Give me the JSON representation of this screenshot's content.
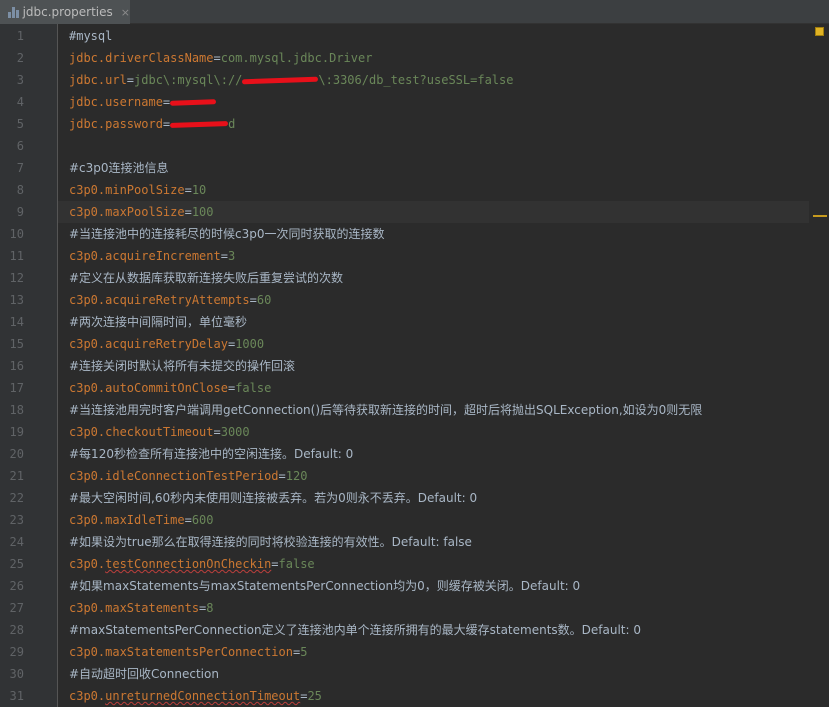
{
  "tab": {
    "filename": "jdbc.properties",
    "close_glyph": "×",
    "icon": "properties-file-icon"
  },
  "colors": {
    "key": "#cc7832",
    "value": "#6a8759",
    "comment": "#a9b7c6",
    "background": "#2b2b2b",
    "gutter": "#313335",
    "line_number": "#606366",
    "warning_marker": "#e0b324"
  },
  "lines": [
    {
      "n": "1",
      "type": "comment",
      "text": "#mysql"
    },
    {
      "n": "2",
      "type": "prop",
      "key": "jdbc.driverClassName",
      "value": "com.mysql.jdbc.Driver"
    },
    {
      "n": "3",
      "type": "prop",
      "key": "jdbc.url",
      "value_pre": "jdbc\\:mysql\\://",
      "value_post": "\\:3306/db_test?useSSL=false",
      "redacted": true
    },
    {
      "n": "4",
      "type": "prop",
      "key": "jdbc.username",
      "value": "",
      "redacted": true
    },
    {
      "n": "5",
      "type": "prop",
      "key": "jdbc.password",
      "value": "d",
      "redacted": true
    },
    {
      "n": "6",
      "type": "blank",
      "text": ""
    },
    {
      "n": "7",
      "type": "comment",
      "text": "#c3p0连接池信息"
    },
    {
      "n": "8",
      "type": "prop",
      "key": "c3p0.minPoolSize",
      "value": "10"
    },
    {
      "n": "9",
      "type": "prop",
      "key": "c3p0.maxPoolSize",
      "value": "100",
      "current": true
    },
    {
      "n": "10",
      "type": "comment",
      "text": "#当连接池中的连接耗尽的时候c3p0一次同时获取的连接数"
    },
    {
      "n": "11",
      "type": "prop",
      "key": "c3p0.acquireIncrement",
      "value": "3"
    },
    {
      "n": "12",
      "type": "comment",
      "text": "#定义在从数据库获取新连接失败后重复尝试的次数"
    },
    {
      "n": "13",
      "type": "prop",
      "key": "c3p0.acquireRetryAttempts",
      "value": "60"
    },
    {
      "n": "14",
      "type": "comment",
      "text": "#两次连接中间隔时间，单位毫秒"
    },
    {
      "n": "15",
      "type": "prop",
      "key": "c3p0.acquireRetryDelay",
      "value": "1000"
    },
    {
      "n": "16",
      "type": "comment",
      "text": "#连接关闭时默认将所有未提交的操作回滚"
    },
    {
      "n": "17",
      "type": "prop",
      "key": "c3p0.autoCommitOnClose",
      "value": "false"
    },
    {
      "n": "18",
      "type": "comment",
      "text": "#当连接池用完时客户端调用getConnection()后等待获取新连接的时间，超时后将抛出SQLException,如设为0则无限"
    },
    {
      "n": "19",
      "type": "prop",
      "key": "c3p0.checkoutTimeout",
      "value": "3000"
    },
    {
      "n": "20",
      "type": "comment",
      "text": "#每120秒检查所有连接池中的空闲连接。Default: 0"
    },
    {
      "n": "21",
      "type": "prop",
      "key": "c3p0.idleConnectionTestPeriod",
      "value": "120"
    },
    {
      "n": "22",
      "type": "comment",
      "text": "#最大空闲时间,60秒内未使用则连接被丢弃。若为0则永不丢弃。Default: 0"
    },
    {
      "n": "23",
      "type": "prop",
      "key": "c3p0.maxIdleTime",
      "value": "600"
    },
    {
      "n": "24",
      "type": "comment",
      "text": "#如果设为true那么在取得连接的同时将校验连接的有效性。Default: false"
    },
    {
      "n": "25",
      "type": "prop",
      "key_pre": "c3p0.",
      "key_squiggle": "testConnectionOnCheckin",
      "value": "false"
    },
    {
      "n": "26",
      "type": "comment",
      "text": "#如果maxStatements与maxStatementsPerConnection均为0，则缓存被关闭。Default: 0"
    },
    {
      "n": "27",
      "type": "prop",
      "key": "c3p0.maxStatements",
      "value": "8"
    },
    {
      "n": "28",
      "type": "comment",
      "text": "#maxStatementsPerConnection定义了连接池内单个连接所拥有的最大缓存statements数。Default: 0"
    },
    {
      "n": "29",
      "type": "prop",
      "key": "c3p0.maxStatementsPerConnection",
      "value": "5"
    },
    {
      "n": "30",
      "type": "comment",
      "text": "#自动超时回收Connection"
    },
    {
      "n": "31",
      "type": "prop",
      "key_pre": "c3p0.",
      "key_squiggle": "unreturnedConnectionTimeout",
      "value": "25"
    }
  ]
}
